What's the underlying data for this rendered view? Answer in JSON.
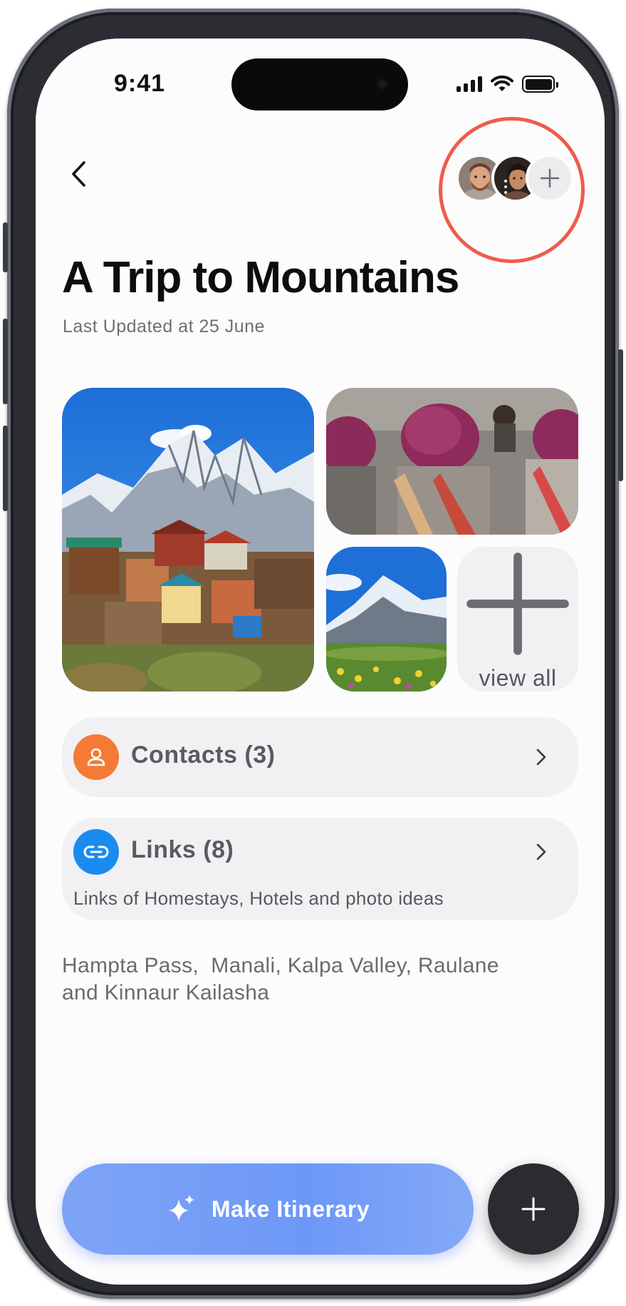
{
  "status_bar": {
    "time": "9:41"
  },
  "header": {
    "title": "A Trip to Mountains",
    "subtitle": "Last Updated at 25 June",
    "back_icon": "chevron-left-icon",
    "members": [
      "man-avatar",
      "woman-avatar"
    ],
    "add_member_icon": "plus-icon"
  },
  "photos": {
    "items": [
      "mountain-village-photo",
      "turban-people-photo",
      "alpine-meadow-photo"
    ],
    "view_all_label": "view all"
  },
  "contacts_card": {
    "label": "Contacts (3)",
    "icon": "person-icon",
    "icon_color": "#f47a35"
  },
  "links_card": {
    "label": "Links (8)",
    "description": "Links of Homestays, Hotels and photo ideas",
    "icon": "link-icon",
    "icon_color": "#1a8cf0"
  },
  "places_text": "Hampta Pass,  Manali, Kalpa Valley, Raulane\nand Kinnaur Kailasha",
  "actions": {
    "make_itinerary_label": "Make Itinerary",
    "make_itinerary_icon": "sparkles-icon",
    "fab_icon": "plus-icon",
    "accent_color": "#6f9af7"
  },
  "highlight_color": "#ee5c4d"
}
